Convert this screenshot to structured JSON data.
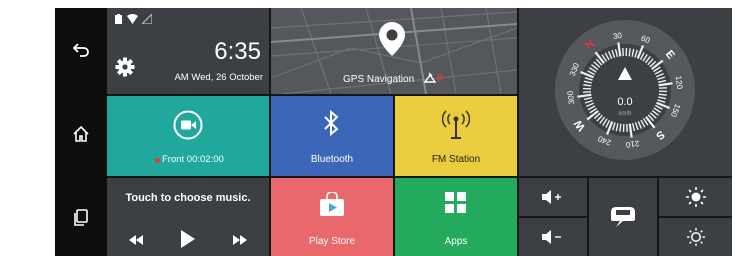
{
  "nav": {
    "back_icon": "back-arrow-icon",
    "home_icon": "home-icon",
    "recents_icon": "recent-apps-icon"
  },
  "clock": {
    "time": "6:35",
    "date": "AM Wed, 26 October"
  },
  "tiles": {
    "gps": {
      "label": "GPS Navigation",
      "badge": "0"
    },
    "camera": {
      "status": "Front 00:02:00"
    },
    "bluetooth": {
      "label": "Bluetooth"
    },
    "fm": {
      "label": "FM Station"
    },
    "music": {
      "title": "Touch to choose music."
    },
    "playstore": {
      "label": "Play Store"
    },
    "apps": {
      "label": "Apps"
    }
  },
  "compass": {
    "speed": "0.0",
    "unit": "km/h",
    "letters": [
      "N",
      "E",
      "S",
      "W"
    ],
    "marks": [
      "30",
      "60",
      "120",
      "150",
      "210",
      "240",
      "300",
      "330"
    ]
  },
  "controls": {
    "volume_up": "volume-up-icon",
    "volume_down": "volume-down-icon",
    "car": "car-assist-icon",
    "brightness_up": "brightness-up-icon",
    "brightness_down": "brightness-down-icon"
  },
  "colors": {
    "camera_tile": "#1fa89b",
    "bluetooth_tile": "#3c67b8",
    "fm_tile": "#eccc3f",
    "playstore_tile": "#e9686c",
    "apps_tile": "#23aa5c",
    "dark_tile": "#3c3f43",
    "recording_dot": "#e53935"
  }
}
